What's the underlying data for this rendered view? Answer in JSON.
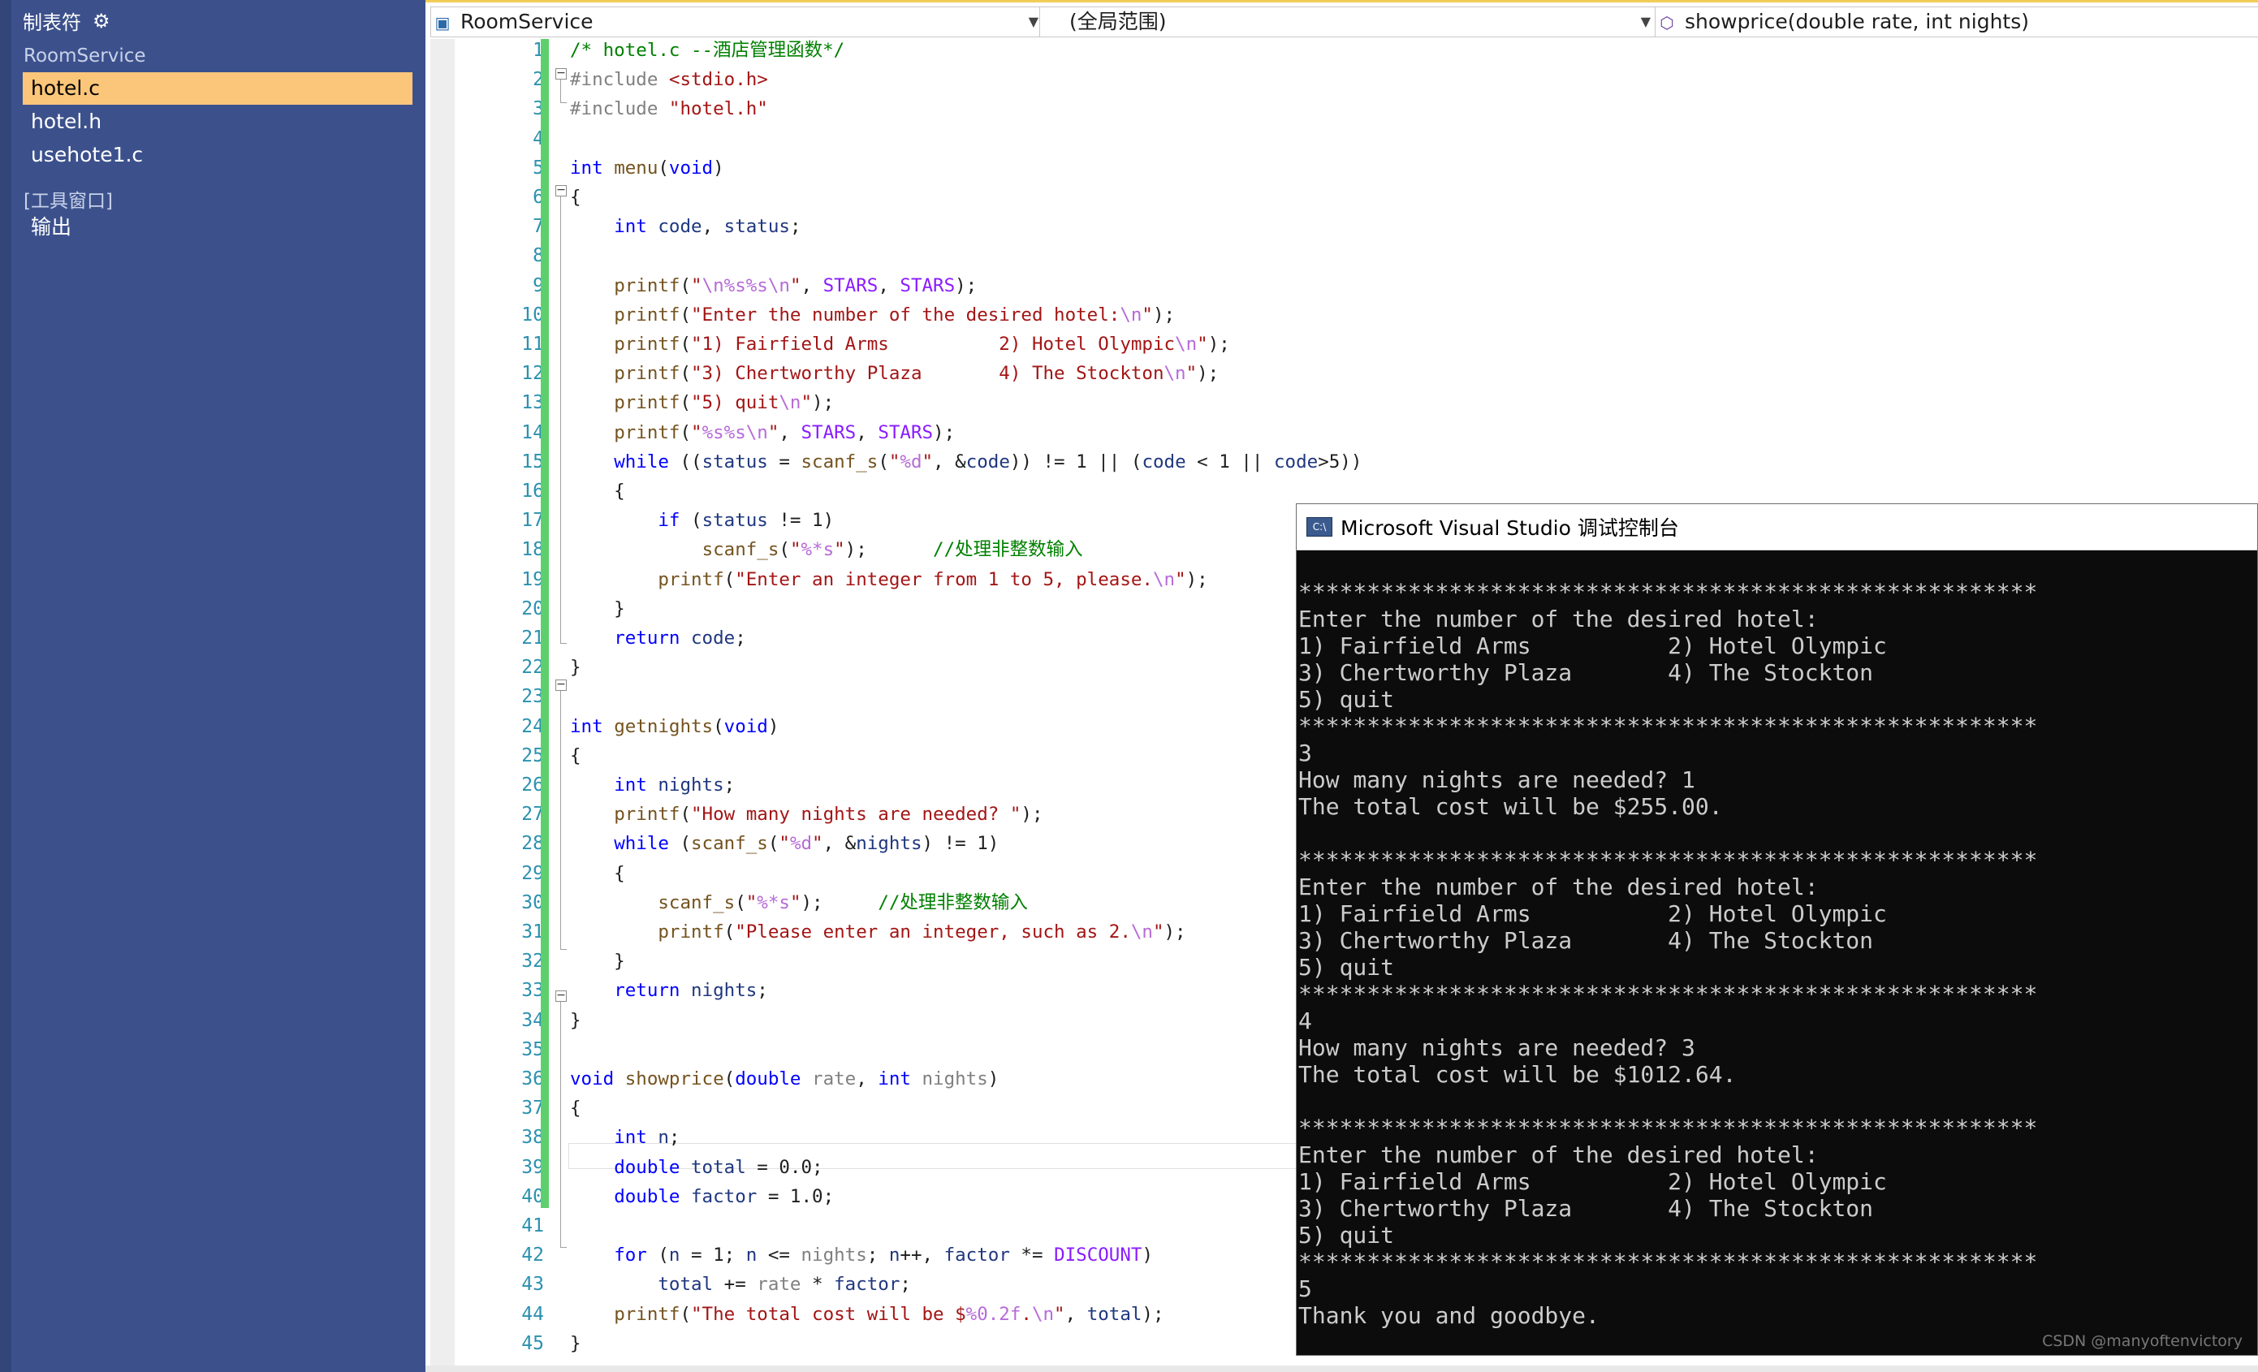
{
  "sidebar": {
    "header_label": "制表符",
    "header_icon": "gear-icon",
    "groups": [
      "RoomService",
      "[工具窗口]"
    ],
    "items": [
      {
        "label": "hotel.c",
        "active": true
      },
      {
        "label": "hotel.h",
        "active": false
      },
      {
        "label": "usehote1.c",
        "active": false
      },
      {
        "label": "输出",
        "active": false
      }
    ]
  },
  "topbar": {
    "project_combo": "RoomService",
    "scope_combo": "(全局范围)",
    "member_combo": "showprice(double rate, int nights)"
  },
  "editor": {
    "line_numbers": [
      "1",
      "2",
      "3",
      "4",
      "5",
      "6",
      "7",
      "8",
      "9",
      "10",
      "11",
      "12",
      "13",
      "14",
      "15",
      "16",
      "17",
      "18",
      "19",
      "20",
      "21",
      "22",
      "23",
      "24",
      "25",
      "26",
      "27",
      "28",
      "29",
      "30",
      "31",
      "32",
      "33",
      "34",
      "35",
      "36",
      "37",
      "38",
      "39",
      "40",
      "41",
      "42",
      "43",
      "44",
      "45"
    ],
    "code_lines": [
      "/* hotel.c --酒店管理函数*/",
      "#include <stdio.h>",
      "#include \"hotel.h\"",
      "",
      "int menu(void)",
      "{",
      "    int code, status;",
      "",
      "    printf(\"\\n%s%s\\n\", STARS, STARS);",
      "    printf(\"Enter the number of the desired hotel:\\n\");",
      "    printf(\"1) Fairfield Arms          2) Hotel Olympic\\n\");",
      "    printf(\"3) Chertworthy Plaza       4) The Stockton\\n\");",
      "    printf(\"5) quit\\n\");",
      "    printf(\"%s%s\\n\", STARS, STARS);",
      "    while ((status = scanf_s(\"%d\", &code)) != 1 || (code < 1 || code>5))",
      "    {",
      "        if (status != 1)",
      "            scanf_s(\"%*s\");      //处理非整数输入",
      "        printf(\"Enter an integer from 1 to 5, please.\\n\");",
      "    }",
      "    return code;",
      "}",
      "",
      "int getnights(void)",
      "{",
      "    int nights;",
      "    printf(\"How many nights are needed? \");",
      "    while (scanf_s(\"%d\", &nights) != 1)",
      "    {",
      "        scanf_s(\"%*s\");     //处理非整数输入",
      "        printf(\"Please enter an integer, such as 2.\\n\");",
      "    }",
      "    return nights;",
      "}",
      "",
      "void showprice(double rate, int nights)",
      "{",
      "    int n;",
      "    double total = 0.0;",
      "    double factor = 1.0;",
      "",
      "    for (n = 1; n <= nights; n++, factor *= DISCOUNT)",
      "        total += rate * factor;",
      "    printf(\"The total cost will be $%0.2f.\\n\", total);",
      "}"
    ]
  },
  "console": {
    "title": "Microsoft Visual Studio 调试控制台",
    "icon": "console-app-icon",
    "lines": [
      "******************************************************",
      "Enter the number of the desired hotel:",
      "1) Fairfield Arms          2) Hotel Olympic",
      "3) Chertworthy Plaza       4) The Stockton",
      "5) quit",
      "******************************************************",
      "3",
      "How many nights are needed? 1",
      "The total cost will be $255.00.",
      "",
      "******************************************************",
      "Enter the number of the desired hotel:",
      "1) Fairfield Arms          2) Hotel Olympic",
      "3) Chertworthy Plaza       4) The Stockton",
      "5) quit",
      "******************************************************",
      "4",
      "How many nights are needed? 3",
      "The total cost will be $1012.64.",
      "",
      "******************************************************",
      "Enter the number of the desired hotel:",
      "1) Fairfield Arms          2) Hotel Olympic",
      "3) Chertworthy Plaza       4) The Stockton",
      "5) quit",
      "******************************************************",
      "5",
      "Thank you and goodbye."
    ]
  },
  "watermark": "CSDN @manyoftenvictory"
}
